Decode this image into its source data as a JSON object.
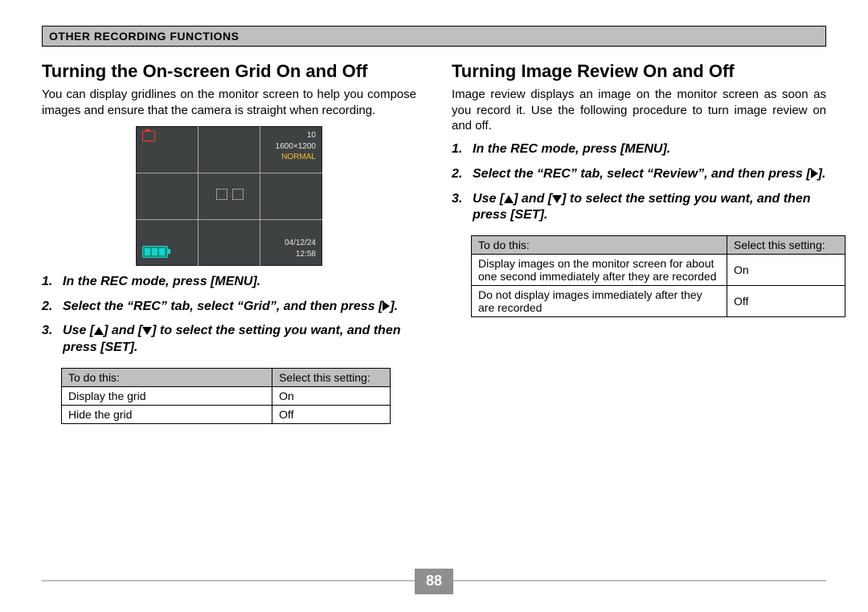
{
  "header": "OTHER RECORDING FUNCTIONS",
  "page_number": "88",
  "screen": {
    "shots_remaining": "10",
    "resolution": "1600×1200",
    "quality": "NORMAL",
    "date": "04/12/24",
    "time": "12:58"
  },
  "left": {
    "title": "Turning the On-screen Grid On and Off",
    "intro": "You can display gridlines on the monitor screen to help you compose images and ensure that the camera is straight when recording.",
    "steps": [
      "In the REC mode, press [MENU].",
      "Select the \"REC\" tab, select \"Grid\", and then press [▶].",
      "Use [▲] and [▼] to select the setting you want, and then press [SET]."
    ],
    "table": {
      "h1": "To do this:",
      "h2": "Select this setting:",
      "rows": [
        {
          "c1": "Display the grid",
          "c2": "On"
        },
        {
          "c1": "Hide the grid",
          "c2": "Off"
        }
      ]
    }
  },
  "right": {
    "title": "Turning Image Review On and Off",
    "intro": "Image review displays an image on the monitor screen as soon as you record it. Use the following procedure to turn image review on and off.",
    "steps": [
      "In the REC mode, press [MENU].",
      "Select the \"REC\" tab, select \"Review\", and then press [▶].",
      "Use [▲] and [▼] to select the setting you want, and then press [SET]."
    ],
    "table": {
      "h1": "To do this:",
      "h2": "Select this setting:",
      "rows": [
        {
          "c1": "Display images on the monitor screen for about one second immediately after they are recorded",
          "c2": "On"
        },
        {
          "c1": "Do not display images immediately after they are recorded",
          "c2": "Off"
        }
      ]
    }
  }
}
